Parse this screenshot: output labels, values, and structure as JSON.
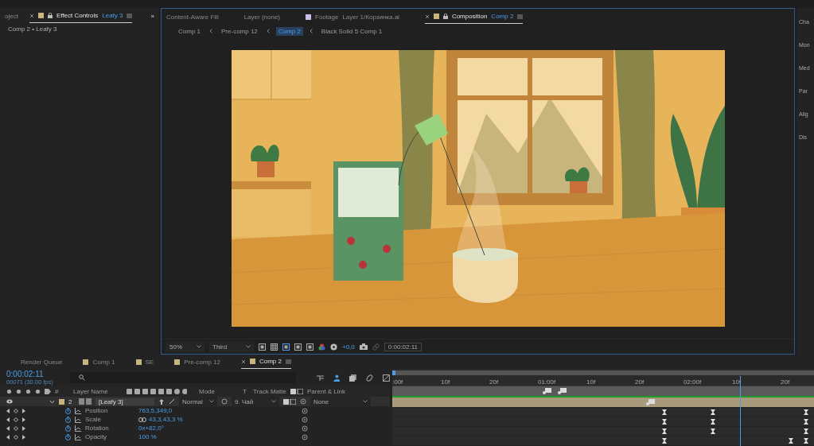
{
  "left_panel": {
    "cut_tab": "oject",
    "tab": {
      "title": "Effect Controls",
      "layer": "Leafy 3",
      "selected": true
    },
    "expand": "»",
    "subtitle": "Comp 2 • Leafy 3"
  },
  "viewer": {
    "tabs": [
      {
        "label": "Content-Aware Fill",
        "kind": "plain",
        "selected": false
      },
      {
        "label": "Layer (none)",
        "kind": "plain",
        "selected": false
      },
      {
        "label": "Footage",
        "name": "Layer 1/Корзинка.ai",
        "kind": "footage",
        "selected": false
      },
      {
        "label": "Composition",
        "name": "Comp 2",
        "kind": "comp",
        "selected": true
      }
    ],
    "breadcrumbs": [
      {
        "label": "Comp 1",
        "selected": false
      },
      {
        "label": "Pre-comp 12",
        "selected": false
      },
      {
        "label": "Comp 2",
        "selected": true
      },
      {
        "label": "Black Solid 5 Comp 1",
        "selected": false
      }
    ],
    "controls": {
      "zoom": "50%",
      "resolution": "Third",
      "exposure": "+0,0",
      "time": "0:00:02:11"
    }
  },
  "right_panel": {
    "items": [
      "Cha",
      "Mon",
      "Med",
      "Par",
      "Alig",
      "Dis"
    ]
  },
  "timeline": {
    "tabs": [
      {
        "label": "Render Queue",
        "kind": "queue",
        "selected": false
      },
      {
        "label": "Comp 1",
        "kind": "comp",
        "selected": false
      },
      {
        "label": "SE",
        "kind": "comp",
        "selected": false
      },
      {
        "label": "Pre-comp 12",
        "kind": "comp",
        "selected": false
      },
      {
        "label": "Comp 2",
        "kind": "comp",
        "selected": true
      }
    ],
    "time": "0:00:02:11",
    "frame_info": "00071 (30.00 fps)",
    "columns": {
      "number": "#",
      "layer_name": "Layer Name",
      "mode": "Mode",
      "t": "T",
      "track_matte": "Track Matte",
      "parent": "Parent & Link"
    },
    "layer": {
      "number": "2",
      "name": "[Leafy 3]",
      "mode": "Normal",
      "matte": "9. Чай",
      "parent": "None"
    },
    "properties": [
      {
        "name": "Position",
        "kind": "plain",
        "value": "763,5,349,0",
        "keyframes": [
          {
            "level": 0.64
          },
          {
            "level": 0.755
          },
          {
            "level": 0.975
          }
        ]
      },
      {
        "name": "Scale",
        "kind": "linked",
        "value": "43,3,43,3 %",
        "keyframes": [
          {
            "level": 0.64
          },
          {
            "level": 0.755
          },
          {
            "level": 0.975
          }
        ]
      },
      {
        "name": "Rotation",
        "kind": "plain",
        "value": "0x+82,0°",
        "keyframes": [
          {
            "level": 0.64
          },
          {
            "level": 0.755
          },
          {
            "level": 0.975
          }
        ]
      },
      {
        "name": "Opacity",
        "kind": "plain",
        "value": "100 %",
        "keyframes": [
          {
            "level": 0.64
          },
          {
            "level": 0.94
          },
          {
            "level": 0.975
          }
        ]
      }
    ],
    "ruler": [
      ":00f",
      "10f",
      "20f",
      "01:00f",
      "10f",
      "20f",
      "02:00f",
      "10f",
      "20f"
    ],
    "playhead": {
      "level": 0.825
    },
    "markers": [
      {
        "level": 0.355
      },
      {
        "level": 0.39
      }
    ],
    "layer_markers": [
      {
        "level": 0.6
      }
    ]
  }
}
